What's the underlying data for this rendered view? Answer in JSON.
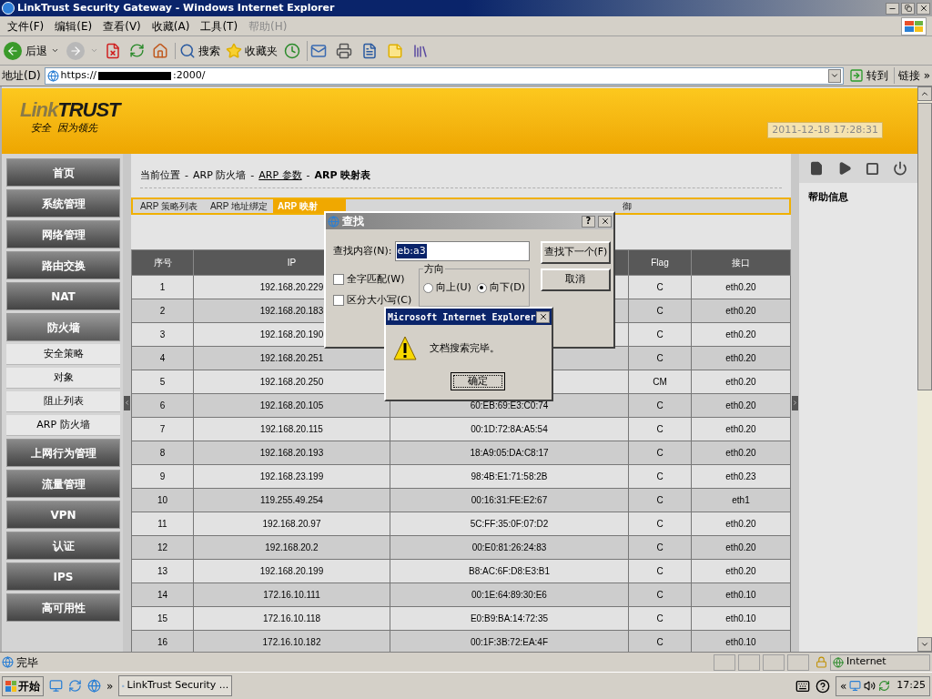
{
  "window": {
    "title": "LinkTrust Security Gateway - Windows Internet Explorer"
  },
  "menu": [
    {
      "label": "文件(F)",
      "disabled": false
    },
    {
      "label": "编辑(E)",
      "disabled": false
    },
    {
      "label": "查看(V)",
      "disabled": false
    },
    {
      "label": "收藏(A)",
      "disabled": false
    },
    {
      "label": "工具(T)",
      "disabled": false
    },
    {
      "label": "帮助(H)",
      "disabled": true
    }
  ],
  "toolbar": {
    "back": "后退",
    "search": "搜索",
    "favorites": "收藏夹"
  },
  "address": {
    "label": "地址(D)",
    "url_start": "https://",
    "url_end": ":2000/",
    "go": "转到",
    "links": "链接",
    "links_more": "»"
  },
  "header": {
    "logo_start": "Link",
    "logo_end": "TRUST",
    "tagline": "安全  因为领先",
    "timestamp": "2011-12-18 17:28:31"
  },
  "nav": [
    {
      "label": "首页",
      "expanded": false
    },
    {
      "label": "系统管理",
      "expanded": false
    },
    {
      "label": "网络管理",
      "expanded": false
    },
    {
      "label": "路由交换",
      "expanded": false
    },
    {
      "label": "NAT",
      "expanded": false
    },
    {
      "label": "防火墙",
      "expanded": true,
      "children": [
        {
          "label": "安全策略"
        },
        {
          "label": "对象"
        },
        {
          "label": "阻止列表"
        },
        {
          "label": "ARP 防火墙"
        }
      ]
    },
    {
      "label": "上网行为管理",
      "expanded": false
    },
    {
      "label": "流量管理",
      "expanded": false
    },
    {
      "label": "VPN",
      "expanded": false
    },
    {
      "label": "认证",
      "expanded": false
    },
    {
      "label": "IPS",
      "expanded": false
    },
    {
      "label": "高可用性",
      "expanded": false
    }
  ],
  "breadcrumb": {
    "separator": "-",
    "items": [
      {
        "text": "当前位置",
        "kind": "plain"
      },
      {
        "text": "ARP 防火墙",
        "kind": "plain"
      },
      {
        "text": "ARP 参数",
        "kind": "link"
      },
      {
        "text": "ARP 映射表",
        "kind": "current"
      }
    ]
  },
  "tabs": [
    {
      "label": "ARP 策略列表",
      "selected": false
    },
    {
      "label": "ARP 地址绑定",
      "selected": false
    },
    {
      "label": "ARP 映射",
      "selected": true
    },
    {
      "label": "御",
      "selected": false
    }
  ],
  "table": {
    "columns": {
      "no": "序号",
      "ip": "IP",
      "flag": "Flag",
      "iface": "接口"
    },
    "rows": [
      {
        "no": "1",
        "ip": "192.168.20.229",
        "flag": "C",
        "iface": "eth0.20"
      },
      {
        "no": "2",
        "ip": "192.168.20.183",
        "flag": "C",
        "iface": "eth0.20"
      },
      {
        "no": "3",
        "ip": "192.168.20.190",
        "flag": "C",
        "iface": "eth0.20"
      },
      {
        "no": "4",
        "ip": "192.168.20.251",
        "flag": "C",
        "iface": "eth0.20"
      },
      {
        "no": "5",
        "ip": "192.168.20.250",
        "flag": "CM",
        "iface": "eth0.20"
      },
      {
        "no": "6",
        "ip": "192.168.20.105",
        "mac": "60:EB:69:E3:C0:74",
        "flag": "C",
        "iface": "eth0.20"
      },
      {
        "no": "7",
        "ip": "192.168.20.115",
        "mac": "00:1D:72:8A:A5:54",
        "flag": "C",
        "iface": "eth0.20"
      },
      {
        "no": "8",
        "ip": "192.168.20.193",
        "mac": "18:A9:05:DA:C8:17",
        "flag": "C",
        "iface": "eth0.20"
      },
      {
        "no": "9",
        "ip": "192.168.23.199",
        "mac": "98:4B:E1:71:58:2B",
        "flag": "C",
        "iface": "eth0.23"
      },
      {
        "no": "10",
        "ip": "119.255.49.254",
        "mac": "00:16:31:FE:E2:67",
        "flag": "C",
        "iface": "eth1"
      },
      {
        "no": "11",
        "ip": "192.168.20.97",
        "mac": "5C:FF:35:0F:07:D2",
        "flag": "C",
        "iface": "eth0.20"
      },
      {
        "no": "12",
        "ip": "192.168.20.2",
        "mac": "00:E0:81:26:24:83",
        "flag": "C",
        "iface": "eth0.20"
      },
      {
        "no": "13",
        "ip": "192.168.20.199",
        "mac": "B8:AC:6F:D8:E3:B1",
        "flag": "C",
        "iface": "eth0.20"
      },
      {
        "no": "14",
        "ip": "172.16.10.111",
        "mac": "00:1E:64:89:30:E6",
        "flag": "C",
        "iface": "eth0.10"
      },
      {
        "no": "15",
        "ip": "172.16.10.118",
        "mac": "E0:B9:BA:14:72:35",
        "flag": "C",
        "iface": "eth0.10"
      },
      {
        "no": "16",
        "ip": "172.16.10.182",
        "mac": "00:1F:3B:72:EA:4F",
        "flag": "C",
        "iface": "eth0.10"
      }
    ]
  },
  "right_panel": {
    "title": "帮助信息"
  },
  "find_dialog": {
    "title": "查找",
    "help": "?",
    "label": "查找内容(N):",
    "value": "eb:a3",
    "checks": [
      {
        "label": "全字匹配(W)",
        "checked": false
      },
      {
        "label": "区分大小写(C)",
        "checked": false
      }
    ],
    "direction": {
      "title": "方向",
      "options": [
        {
          "label": "向上(U)",
          "selected": false
        },
        {
          "label": "向下(D)",
          "selected": true
        }
      ]
    },
    "buttons": [
      "查找下一个(F)",
      "取消"
    ]
  },
  "alert": {
    "title": "Microsoft Internet Explorer",
    "message": "文档搜索完毕。",
    "button": "确定"
  },
  "status_bar": {
    "text": "完毕",
    "zone": "Internet"
  },
  "taskbar": {
    "start": "开始",
    "more": "»",
    "task": "LinkTrust Security ...",
    "tray_more": "«",
    "clock": "17:25"
  }
}
